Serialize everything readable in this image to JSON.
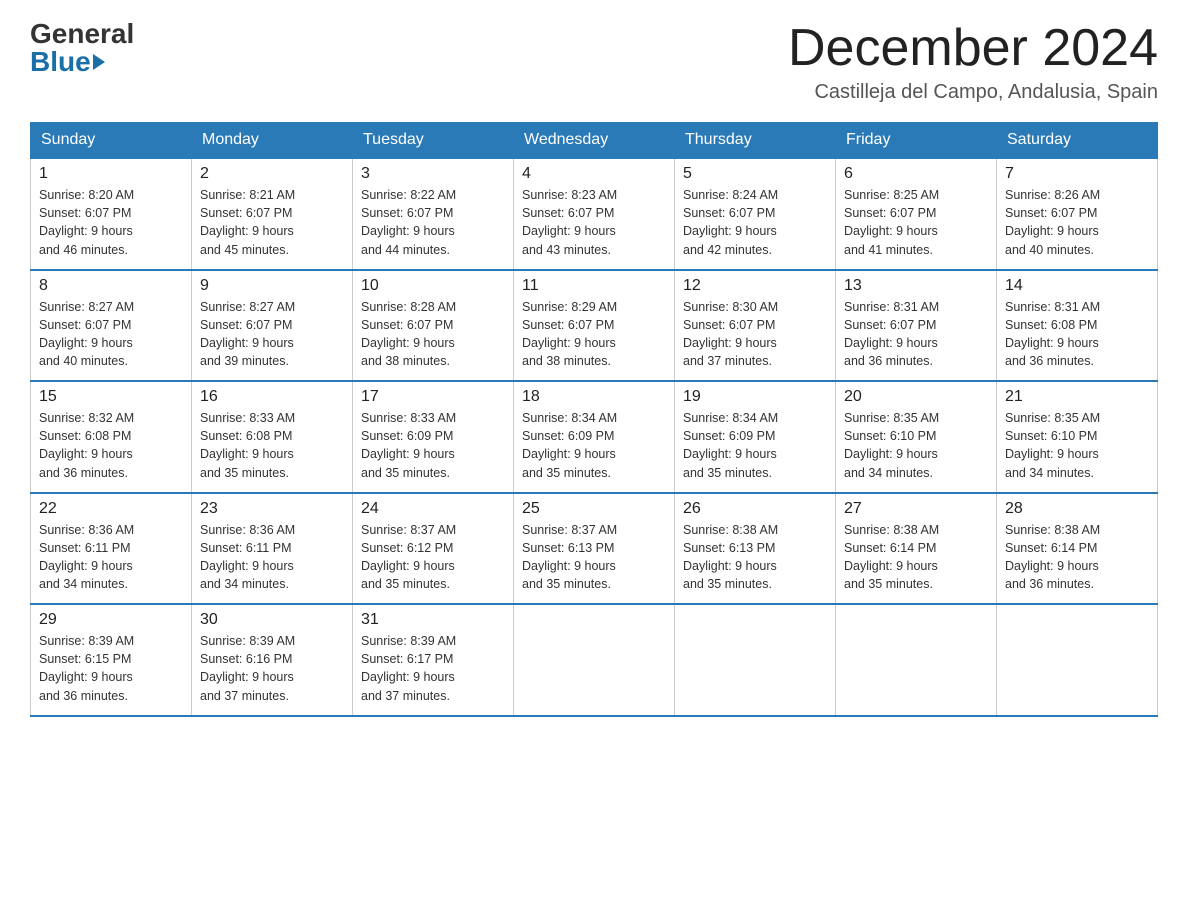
{
  "header": {
    "logo_general": "General",
    "logo_blue": "Blue",
    "month_title": "December 2024",
    "location": "Castilleja del Campo, Andalusia, Spain"
  },
  "days_of_week": [
    "Sunday",
    "Monday",
    "Tuesday",
    "Wednesday",
    "Thursday",
    "Friday",
    "Saturday"
  ],
  "weeks": [
    [
      {
        "day": "1",
        "sunrise": "8:20 AM",
        "sunset": "6:07 PM",
        "daylight": "9 hours and 46 minutes."
      },
      {
        "day": "2",
        "sunrise": "8:21 AM",
        "sunset": "6:07 PM",
        "daylight": "9 hours and 45 minutes."
      },
      {
        "day": "3",
        "sunrise": "8:22 AM",
        "sunset": "6:07 PM",
        "daylight": "9 hours and 44 minutes."
      },
      {
        "day": "4",
        "sunrise": "8:23 AM",
        "sunset": "6:07 PM",
        "daylight": "9 hours and 43 minutes."
      },
      {
        "day": "5",
        "sunrise": "8:24 AM",
        "sunset": "6:07 PM",
        "daylight": "9 hours and 42 minutes."
      },
      {
        "day": "6",
        "sunrise": "8:25 AM",
        "sunset": "6:07 PM",
        "daylight": "9 hours and 41 minutes."
      },
      {
        "day": "7",
        "sunrise": "8:26 AM",
        "sunset": "6:07 PM",
        "daylight": "9 hours and 40 minutes."
      }
    ],
    [
      {
        "day": "8",
        "sunrise": "8:27 AM",
        "sunset": "6:07 PM",
        "daylight": "9 hours and 40 minutes."
      },
      {
        "day": "9",
        "sunrise": "8:27 AM",
        "sunset": "6:07 PM",
        "daylight": "9 hours and 39 minutes."
      },
      {
        "day": "10",
        "sunrise": "8:28 AM",
        "sunset": "6:07 PM",
        "daylight": "9 hours and 38 minutes."
      },
      {
        "day": "11",
        "sunrise": "8:29 AM",
        "sunset": "6:07 PM",
        "daylight": "9 hours and 38 minutes."
      },
      {
        "day": "12",
        "sunrise": "8:30 AM",
        "sunset": "6:07 PM",
        "daylight": "9 hours and 37 minutes."
      },
      {
        "day": "13",
        "sunrise": "8:31 AM",
        "sunset": "6:07 PM",
        "daylight": "9 hours and 36 minutes."
      },
      {
        "day": "14",
        "sunrise": "8:31 AM",
        "sunset": "6:08 PM",
        "daylight": "9 hours and 36 minutes."
      }
    ],
    [
      {
        "day": "15",
        "sunrise": "8:32 AM",
        "sunset": "6:08 PM",
        "daylight": "9 hours and 36 minutes."
      },
      {
        "day": "16",
        "sunrise": "8:33 AM",
        "sunset": "6:08 PM",
        "daylight": "9 hours and 35 minutes."
      },
      {
        "day": "17",
        "sunrise": "8:33 AM",
        "sunset": "6:09 PM",
        "daylight": "9 hours and 35 minutes."
      },
      {
        "day": "18",
        "sunrise": "8:34 AM",
        "sunset": "6:09 PM",
        "daylight": "9 hours and 35 minutes."
      },
      {
        "day": "19",
        "sunrise": "8:34 AM",
        "sunset": "6:09 PM",
        "daylight": "9 hours and 35 minutes."
      },
      {
        "day": "20",
        "sunrise": "8:35 AM",
        "sunset": "6:10 PM",
        "daylight": "9 hours and 34 minutes."
      },
      {
        "day": "21",
        "sunrise": "8:35 AM",
        "sunset": "6:10 PM",
        "daylight": "9 hours and 34 minutes."
      }
    ],
    [
      {
        "day": "22",
        "sunrise": "8:36 AM",
        "sunset": "6:11 PM",
        "daylight": "9 hours and 34 minutes."
      },
      {
        "day": "23",
        "sunrise": "8:36 AM",
        "sunset": "6:11 PM",
        "daylight": "9 hours and 34 minutes."
      },
      {
        "day": "24",
        "sunrise": "8:37 AM",
        "sunset": "6:12 PM",
        "daylight": "9 hours and 35 minutes."
      },
      {
        "day": "25",
        "sunrise": "8:37 AM",
        "sunset": "6:13 PM",
        "daylight": "9 hours and 35 minutes."
      },
      {
        "day": "26",
        "sunrise": "8:38 AM",
        "sunset": "6:13 PM",
        "daylight": "9 hours and 35 minutes."
      },
      {
        "day": "27",
        "sunrise": "8:38 AM",
        "sunset": "6:14 PM",
        "daylight": "9 hours and 35 minutes."
      },
      {
        "day": "28",
        "sunrise": "8:38 AM",
        "sunset": "6:14 PM",
        "daylight": "9 hours and 36 minutes."
      }
    ],
    [
      {
        "day": "29",
        "sunrise": "8:39 AM",
        "sunset": "6:15 PM",
        "daylight": "9 hours and 36 minutes."
      },
      {
        "day": "30",
        "sunrise": "8:39 AM",
        "sunset": "6:16 PM",
        "daylight": "9 hours and 37 minutes."
      },
      {
        "day": "31",
        "sunrise": "8:39 AM",
        "sunset": "6:17 PM",
        "daylight": "9 hours and 37 minutes."
      },
      null,
      null,
      null,
      null
    ]
  ]
}
